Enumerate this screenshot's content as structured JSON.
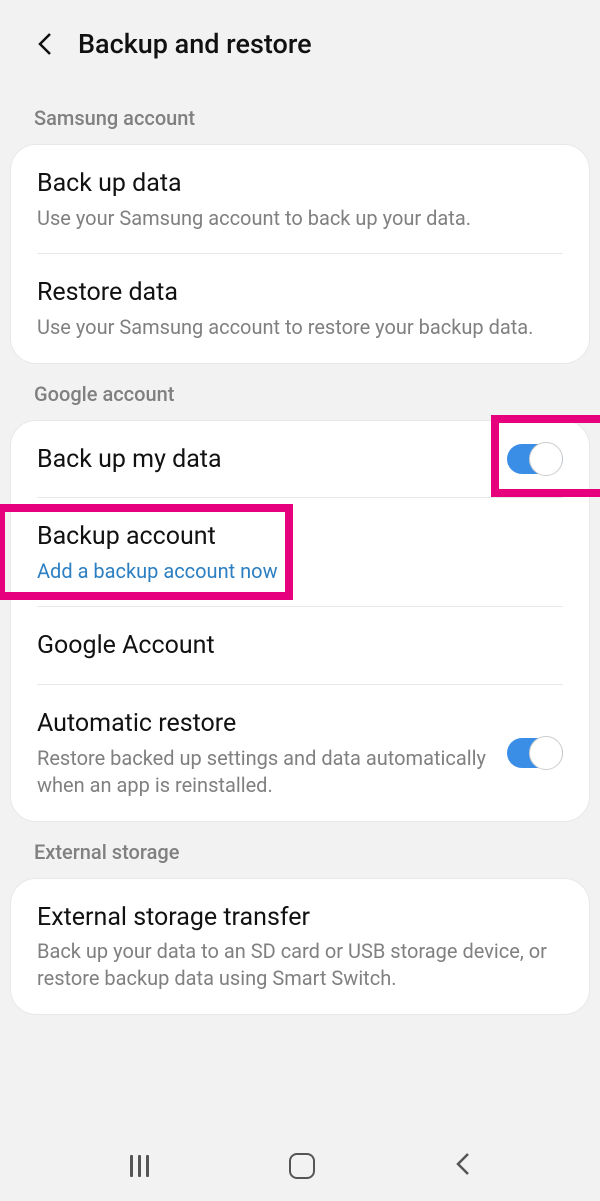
{
  "header": {
    "title": "Backup and restore"
  },
  "sections": {
    "samsung": {
      "label": "Samsung account",
      "backup": {
        "title": "Back up data",
        "desc": "Use your Samsung account to back up your data."
      },
      "restore": {
        "title": "Restore data",
        "desc": "Use your Samsung account to restore your backup data."
      }
    },
    "google": {
      "label": "Google account",
      "backup_my_data": {
        "title": "Back up my data"
      },
      "backup_account": {
        "title": "Backup account",
        "link": "Add a backup account now"
      },
      "google_account": {
        "title": "Google Account"
      },
      "auto_restore": {
        "title": "Automatic restore",
        "desc": "Restore backed up settings and data automatically when an app is reinstalled."
      }
    },
    "external": {
      "label": "External storage",
      "transfer": {
        "title": "External storage transfer",
        "desc": "Back up your data to an SD card or USB storage device, or restore backup data using Smart Switch."
      }
    }
  },
  "colors": {
    "highlight": "#e6007e",
    "toggle_on": "#3a8ee6",
    "link": "#2b7fc2"
  }
}
